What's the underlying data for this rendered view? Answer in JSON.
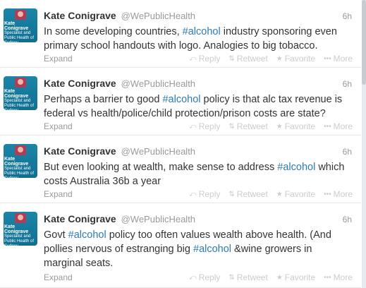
{
  "author": {
    "name": "Kate Conigrave",
    "handle": "@WePublicHealth",
    "avatar_text": "Kate Conigrave",
    "avatar_subtext": "Specialist and Public Health of Sydney"
  },
  "actions": {
    "expand": "Expand",
    "reply": "Reply",
    "retweet": "Retweet",
    "favorite": "Favorite",
    "more": "More"
  },
  "tweets": [
    {
      "time": "6h",
      "parts": [
        "In some developing countries, ",
        "#alcohol",
        " industry sponsoring even primary school handouts with logo. Analogies to big tobacco."
      ]
    },
    {
      "time": "6h",
      "parts": [
        "Perhaps a barrier to good ",
        "#alcohol",
        " policy is that alc tax revenue is federal vs health/police/child protection/prison costs are state?"
      ]
    },
    {
      "time": "6h",
      "parts": [
        "But even looking at wealth, make sense to address ",
        "#alcohol",
        " which costs Australia 36b a year"
      ]
    },
    {
      "time": "6h",
      "parts": [
        "Govt ",
        "#alcohol",
        " policy too often values wealth above health. (And pollies nervous of estranging big ",
        "#alcohol",
        " &wine growers in marginal seats."
      ]
    }
  ],
  "colors": {
    "hashtag": "#2b7bb9",
    "muted": "#999999",
    "avatar_bg": "#1b86a8"
  }
}
